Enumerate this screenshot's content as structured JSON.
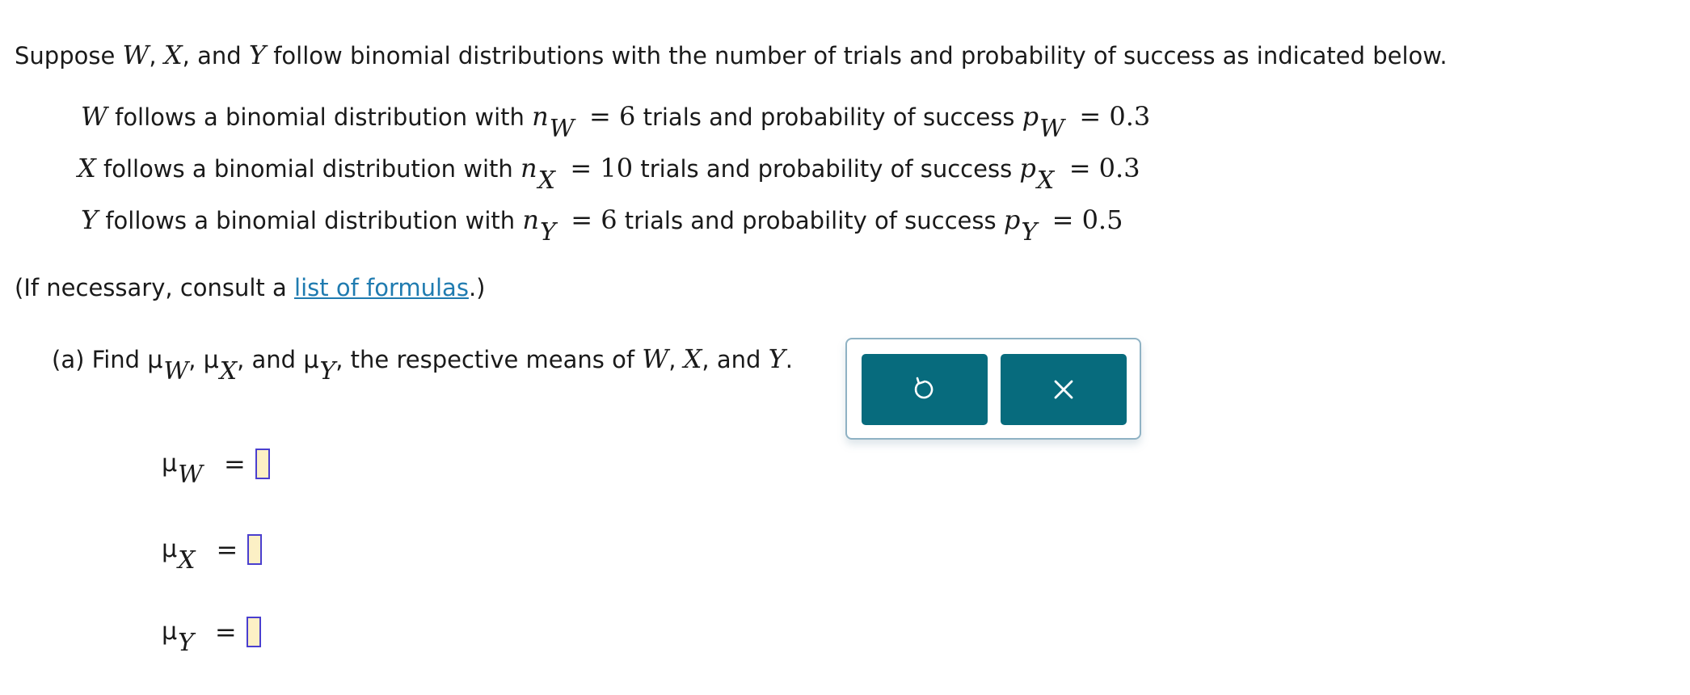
{
  "intro": {
    "text_pre": "Suppose ",
    "v1": "W",
    "sep1": ", ",
    "v2": "X",
    "sep2": ", and ",
    "v3": "Y",
    "text_post": " follow binomial distributions with the number of trials and probability of success as indicated below."
  },
  "distributions": [
    {
      "var": "W",
      "text1": " follows a binomial distribution with ",
      "n_sym": "n",
      "n_sub": "W",
      "n_val": "= 6",
      "text2": " trials and probability of success ",
      "p_sym": "p",
      "p_sub": "W",
      "p_val": "= 0.3"
    },
    {
      "var": "X",
      "text1": " follows a binomial distribution with ",
      "n_sym": "n",
      "n_sub": "X",
      "n_val": "= 10",
      "text2": " trials and probability of success ",
      "p_sym": "p",
      "p_sub": "X",
      "p_val": "= 0.3"
    },
    {
      "var": "Y",
      "text1": " follows a binomial distribution with ",
      "n_sym": "n",
      "n_sub": "Y",
      "n_val": "= 6",
      "text2": " trials and probability of success ",
      "p_sym": "p",
      "p_sub": "Y",
      "p_val": "= 0.5"
    }
  ],
  "consult": {
    "pre": "(If necessary, consult a ",
    "link": "list of formulas",
    "post": ".)"
  },
  "part_a": {
    "label": "(a) Find ",
    "mu": "μ",
    "s1": "W",
    "c1": ", ",
    "s2": "X",
    "c2": ", and ",
    "s3": "Y",
    "c3": ", the respective means of ",
    "v1": "W",
    "d1": ", ",
    "v2": "X",
    "d2": ", and ",
    "v3": "Y",
    "end": "."
  },
  "answers": [
    {
      "mu": "μ",
      "sub": "W",
      "eq": "=",
      "value": ""
    },
    {
      "mu": "μ",
      "sub": "X",
      "eq": "=",
      "value": ""
    },
    {
      "mu": "μ",
      "sub": "Y",
      "eq": "=",
      "value": ""
    }
  ],
  "tools": {
    "reset_icon": "undo-icon",
    "close_icon": "close-icon"
  }
}
